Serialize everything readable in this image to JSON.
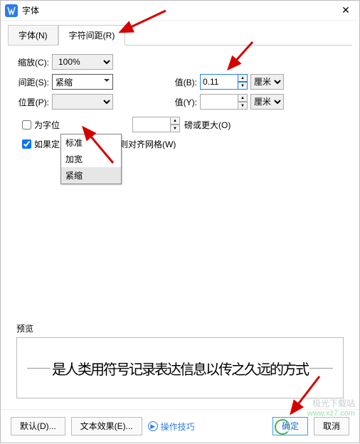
{
  "window": {
    "title": "字体"
  },
  "tabs": [
    {
      "label": "字体(N)"
    },
    {
      "label": "字符间距(R)"
    }
  ],
  "scale": {
    "label": "缩放(C):",
    "value": "100%"
  },
  "spacing": {
    "label": "间距(S):",
    "value": "紧缩",
    "options": [
      "标准",
      "加宽",
      "紧缩"
    ],
    "value_b_label": "值(B):",
    "value_b": "0.11",
    "unit_b": "厘米"
  },
  "position": {
    "label": "位置(P):",
    "value": "",
    "value_y_label": "值(Y):",
    "value_y": "",
    "unit_y": "厘米"
  },
  "kerning": {
    "label": "为字位",
    "suffix_label": "磅或更大(O)"
  },
  "snap": {
    "label": "如果定义了文档网格，则对齐网格(W)"
  },
  "preview": {
    "label": "预览",
    "text": "是人类用符号记录表达信息以传之久远的方式"
  },
  "footer": {
    "defaults": "默认(D)...",
    "text_effects": "文本效果(E)...",
    "tips": "操作技巧",
    "ok": "确定",
    "cancel": "取消"
  },
  "watermark": {
    "line1": "极光下载站",
    "line2": "www.xz7.com"
  }
}
